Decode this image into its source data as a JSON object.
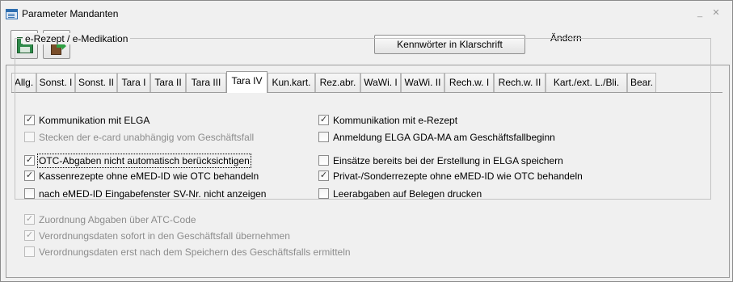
{
  "window": {
    "title": "Parameter Mandanten",
    "minimize_glyph": "_",
    "close_glyph": "✕"
  },
  "toolbar": {
    "save_icon": "save-icon",
    "exit_icon": "exit-door-icon",
    "password_button_label": "Kennwörter in Klarschrift",
    "mode_label": "Ändern"
  },
  "tabs": [
    {
      "label": "Allg."
    },
    {
      "label": "Sonst. I"
    },
    {
      "label": "Sonst. II"
    },
    {
      "label": "Tara I"
    },
    {
      "label": "Tara II"
    },
    {
      "label": "Tara III"
    },
    {
      "label": "Tara IV"
    },
    {
      "label": "Kun.kart."
    },
    {
      "label": "Rez.abr."
    },
    {
      "label": "WaWi. I"
    },
    {
      "label": "WaWi. II"
    },
    {
      "label": "Rech.w. I"
    },
    {
      "label": "Rech.w. II"
    },
    {
      "label": "Kart./ext. L./Bli."
    },
    {
      "label": "Bear."
    }
  ],
  "active_tab": "Tara IV",
  "group": {
    "title": "e-Rezept / e-Medikation"
  },
  "options": [
    {
      "label": "Kommunikation mit ELGA",
      "checked": true,
      "enabled": true
    },
    {
      "label": "Stecken der e-card unabhängig vom Geschäftsfall",
      "checked": false,
      "enabled": false
    },
    {
      "label": "OTC-Abgaben nicht automatisch berücksichtigen",
      "checked": true,
      "enabled": true,
      "focused": true
    },
    {
      "label": "Kassenrezepte ohne eMED-ID wie OTC behandeln",
      "checked": true,
      "enabled": true
    },
    {
      "label": "nach eMED-ID Eingabefenster SV-Nr. nicht anzeigen",
      "checked": false,
      "enabled": true
    },
    {
      "label": "Kommunikation mit e-Rezept",
      "checked": true,
      "enabled": true
    },
    {
      "label": "Anmeldung ELGA GDA-MA am Geschäftsfallbeginn",
      "checked": false,
      "enabled": true
    },
    {
      "label": "Einsätze bereits bei der Erstellung in ELGA speichern",
      "checked": false,
      "enabled": true
    },
    {
      "label": "Privat-/Sonderrezepte ohne eMED-ID wie OTC behandeln",
      "checked": true,
      "enabled": true
    },
    {
      "label": "Leerabgaben auf Belegen drucken",
      "checked": false,
      "enabled": true
    },
    {
      "label": "Zuordnung Abgaben über ATC-Code",
      "checked": true,
      "enabled": false
    },
    {
      "label": "Verordnungsdaten sofort in den Geschäftsfall übernehmen",
      "checked": true,
      "enabled": false
    },
    {
      "label": "Verordnungsdaten erst nach dem Speichern des Geschäftsfalls ermitteln",
      "checked": false,
      "enabled": false
    }
  ],
  "colors": {
    "window_bg": "#f0f0f0",
    "border": "#9c9c9c",
    "disabled_text": "#8c8c8c"
  }
}
